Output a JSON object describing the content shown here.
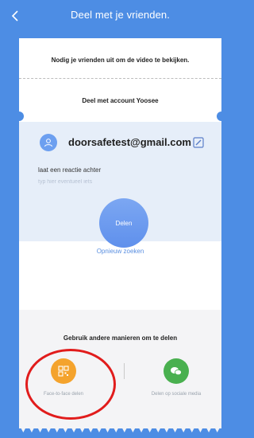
{
  "header": {
    "title": "Deel met je vrienden."
  },
  "card": {
    "invite_text": "Nodig je vrienden uit om de video te bekijken.",
    "account_title": "Deel met account Yoosee",
    "email": "doorsafetest@gmail.com",
    "comment_label": "laat een reactie achter",
    "comment_placeholder": "typ hier eventueel iets",
    "share_button": "Delen",
    "search_again": "Opnieuw zoeken",
    "other_title": "Gebruik andere manieren om te delen",
    "options": [
      {
        "label": "Face-to-face delen",
        "icon": "qr-code-icon",
        "color": "#f4a32d"
      },
      {
        "label": "Delen op sociale media",
        "icon": "chat-bubbles-icon",
        "color": "#49b04f"
      }
    ]
  },
  "colors": {
    "background": "#4d8de4",
    "accent": "#5f90ec",
    "highlight": "#e11c1c"
  }
}
